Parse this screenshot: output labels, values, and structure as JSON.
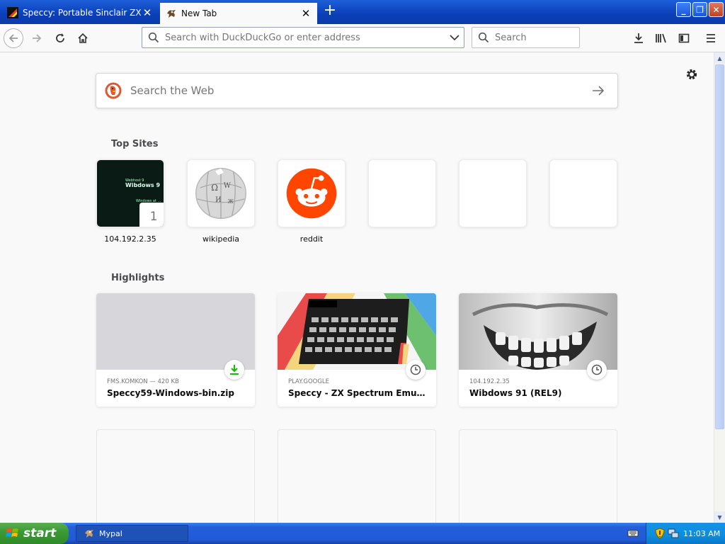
{
  "tabs": [
    {
      "title": "Speccy: Portable Sinclair ZX Spectrum",
      "active": false
    },
    {
      "title": "New Tab",
      "active": true
    }
  ],
  "toolbar": {
    "url_placeholder": "Search with DuckDuckGo or enter address",
    "search_placeholder": "Search"
  },
  "newtab": {
    "web_search_placeholder": "Search the Web",
    "top_sites_title": "Top Sites",
    "top_sites": [
      {
        "label": "104.192.2.35",
        "badge": "1",
        "thumb_line1": "Webhost 9",
        "thumb_line2": "Wibdows 9",
        "thumb_line3": "Windows at ..."
      },
      {
        "label": "wikipedia"
      },
      {
        "label": "reddit"
      },
      {
        "label": ""
      },
      {
        "label": ""
      },
      {
        "label": ""
      }
    ],
    "highlights_title": "Highlights",
    "highlights": [
      {
        "context": "FMS.KOMKON — 420 KB",
        "title": "Speccy59-Windows-bin.zip",
        "badge": "download-icon"
      },
      {
        "context": "PLAY.GOOGLE",
        "title": "Speccy - ZX Spectrum Emulator - Apps on Google Play",
        "badge": "clock-icon"
      },
      {
        "context": "104.192.2.35",
        "title": "Wibdows 91 (REL9)",
        "badge": "clock-icon"
      }
    ]
  },
  "taskbar": {
    "start_label": "start",
    "task_label": "Mypal",
    "clock": "11:03 AM"
  },
  "colors": {
    "titlebar": "#0a3fb8",
    "reddit": "#ff4500",
    "download_green": "#12bc00",
    "start_green": "#3c9b34",
    "taskbar_blue": "#225ad6"
  }
}
